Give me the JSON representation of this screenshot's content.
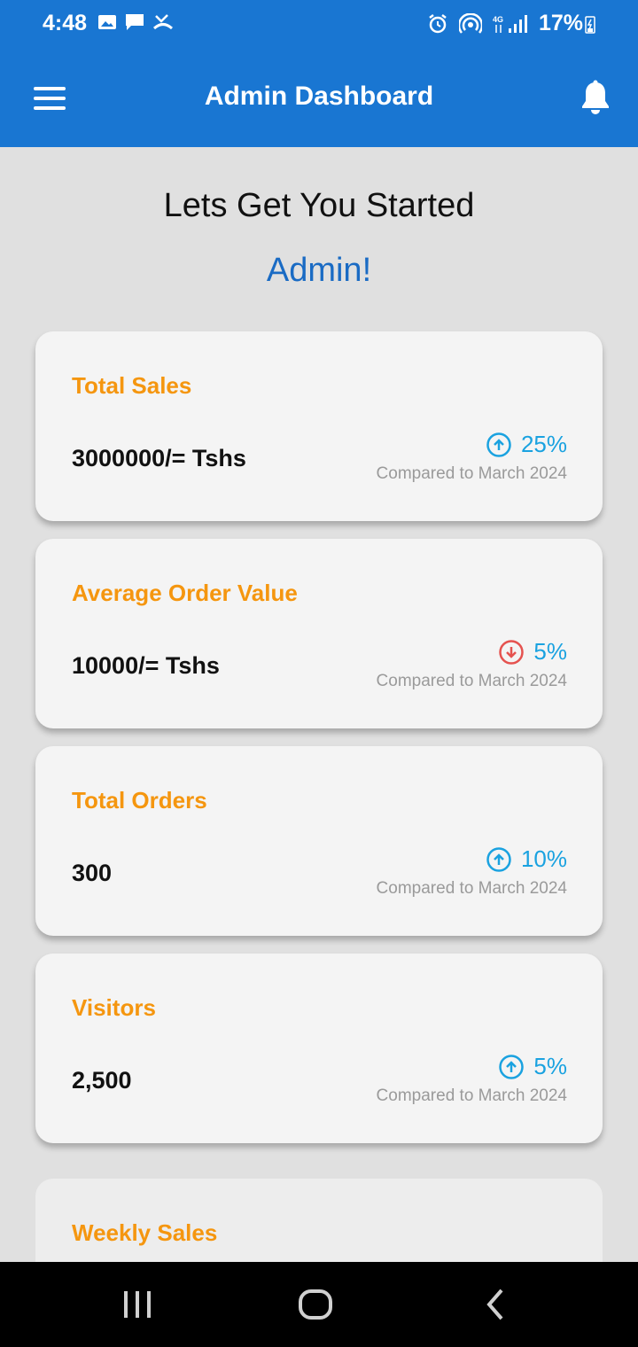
{
  "status": {
    "time": "4:48",
    "battery": "17%"
  },
  "header": {
    "title": "Admin Dashboard"
  },
  "greeting": {
    "line1": "Lets Get You Started",
    "name": "Admin!"
  },
  "cards": [
    {
      "title": "Total Sales",
      "value": "3000000/= Tshs",
      "change": "25%",
      "direction": "up",
      "compare": "Compared to March 2024"
    },
    {
      "title": "Average Order Value",
      "value": "10000/= Tshs",
      "change": "5%",
      "direction": "down",
      "compare": "Compared to March 2024"
    },
    {
      "title": "Total Orders",
      "value": "300",
      "change": "10%",
      "direction": "up",
      "compare": "Compared to March 2024"
    },
    {
      "title": "Visitors",
      "value": "2,500",
      "change": "5%",
      "direction": "up",
      "compare": "Compared to March 2024"
    }
  ],
  "weekly": {
    "title": "Weekly Sales"
  },
  "colors": {
    "primary": "#1976d2",
    "accent": "#f5960f",
    "up": "#1aa2e0",
    "down": "#e5524f"
  }
}
